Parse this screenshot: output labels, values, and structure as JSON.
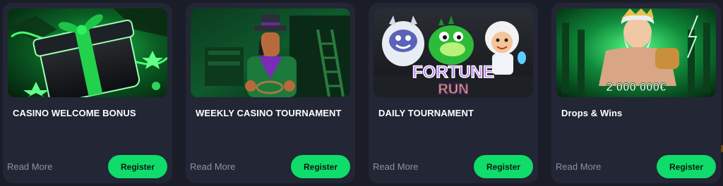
{
  "cards": [
    {
      "title": "CASINO WELCOME BONUS",
      "read_more": "Read More",
      "register": "Register",
      "image_icon": "gift-box-icon"
    },
    {
      "title": "WEEKLY CASINO TOURNAMENT",
      "read_more": "Read More",
      "register": "Register",
      "image_icon": "cowboy-character-icon"
    },
    {
      "title": "DAILY TOURNAMENT",
      "read_more": "Read More",
      "register": "Register",
      "image_icon": "fortune-run-characters-icon",
      "image_text": [
        "FORTUNE",
        "RUN"
      ]
    },
    {
      "title": "Drops & Wins",
      "read_more": "Read More",
      "register": "Register",
      "image_icon": "zeus-character-icon",
      "image_text": "2 000 000€"
    }
  ],
  "colors": {
    "page_bg": "#1a1d28",
    "card_bg": "#232634",
    "accent_green": "#0fdc6a",
    "muted_text": "#8e93a3"
  }
}
